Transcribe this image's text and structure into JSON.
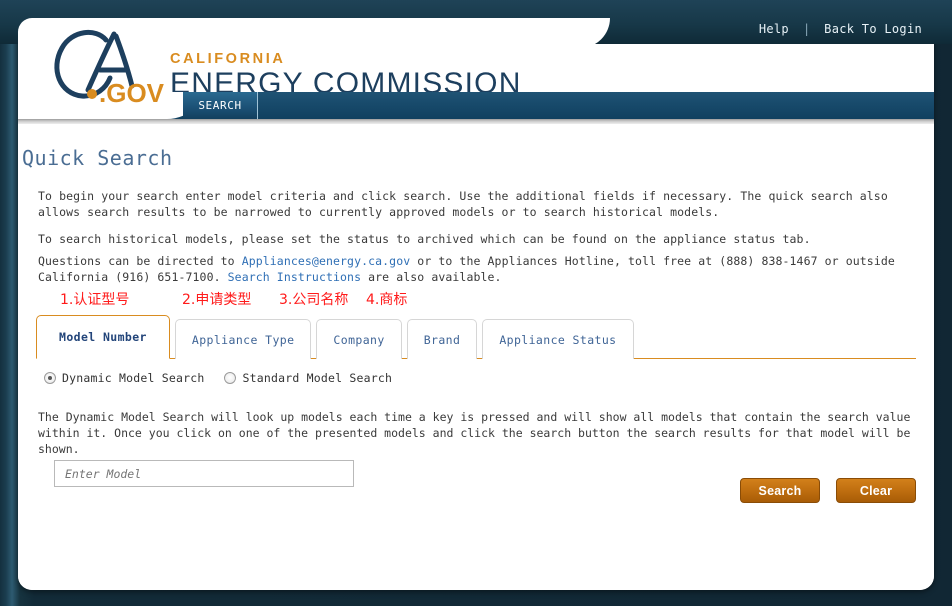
{
  "topnav": {
    "help": "Help",
    "separator": "|",
    "back_to_login": "Back To Login"
  },
  "brand": {
    "logo_text": "CA",
    "logo_suffix": ".GOV",
    "line1": "CALIFORNIA",
    "line2": "ENERGY COMMISSION"
  },
  "navband": {
    "search_tab": "SEARCH"
  },
  "page": {
    "title": "Quick Search",
    "paragraph1": "To begin your search enter model criteria and click search. Use the additional fields if necessary. The quick search also allows search results to be narrowed to currently approved models or to search historical models.",
    "paragraph2": "To search historical models, please set the status to archived which can be found on the appliance status tab.",
    "paragraph3_before": "Questions can be directed to ",
    "paragraph3_email": "Appliances@energy.ca.gov",
    "paragraph3_mid": " or to the Appliances Hotline, toll free at (888) 838-1467 or outside California (916) 651-7100. ",
    "paragraph3_link": "Search Instructions",
    "paragraph3_after": " are also available."
  },
  "annotations": {
    "a1": "1.认证型号",
    "a2": "2.申请类型",
    "a3": "3.公司名称",
    "a4": "4.商标"
  },
  "tabs": [
    {
      "label": "Model Number",
      "active": true
    },
    {
      "label": "Appliance Type",
      "active": false
    },
    {
      "label": "Company",
      "active": false
    },
    {
      "label": "Brand",
      "active": false
    },
    {
      "label": "Appliance Status",
      "active": false
    }
  ],
  "search_mode": {
    "dynamic_label": "Dynamic Model Search",
    "standard_label": "Standard Model Search",
    "selected": "dynamic"
  },
  "helper_text": "The Dynamic Model Search will look up models each time a key is pressed and will show all models that contain the search value within it. Once you click on one of the presented models and click the search button the search results for that model will be shown.",
  "model_field": {
    "value": "",
    "placeholder": "Enter Model"
  },
  "buttons": {
    "search": "Search",
    "clear": "Clear"
  },
  "colors": {
    "frame_navy": "#153243",
    "brand_navy": "#1d3f5e",
    "brand_orange": "#d98c20",
    "link_blue": "#2f6fb5",
    "annotation_red": "#ff1a1a",
    "button_orange": "#c06f10",
    "title_blue": "#4a6d93"
  }
}
